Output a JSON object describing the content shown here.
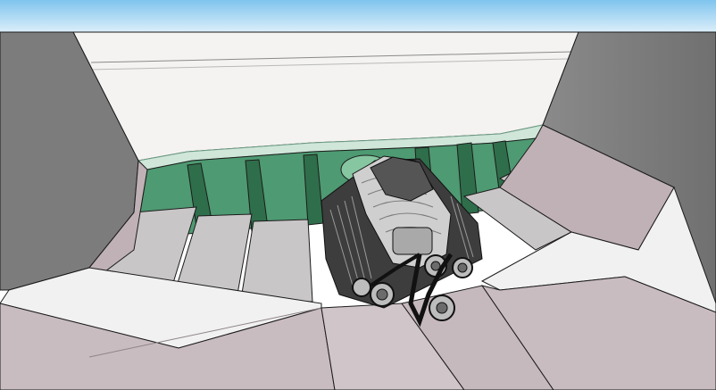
{
  "app": {
    "view": "3d-model-viewport",
    "model_subject": "supercharged-engine-in-engine-bay"
  },
  "colors": {
    "sky_top": "#7fc4ee",
    "sky_bottom": "#e6f3fb",
    "back_wall": "#f4f3f1",
    "green_wall": "#4e9a72",
    "green_dark": "#2f6e4b",
    "green_light": "#86c6a0",
    "pale_green_ledge": "#cfe6d9",
    "side_gray": "#7c7c7c",
    "side_gray_light": "#9a9a9a",
    "floor_gray": "#b9b6b8",
    "mauve_wall": "#bfb1b6",
    "mauve_light": "#d7cdd0",
    "engine_dark": "#2a2a2a",
    "engine_mid": "#6b6b6b",
    "engine_light": "#cfcfcf",
    "edge": "#1b1b1b"
  },
  "icons": {
    "engine": "engine-icon"
  }
}
